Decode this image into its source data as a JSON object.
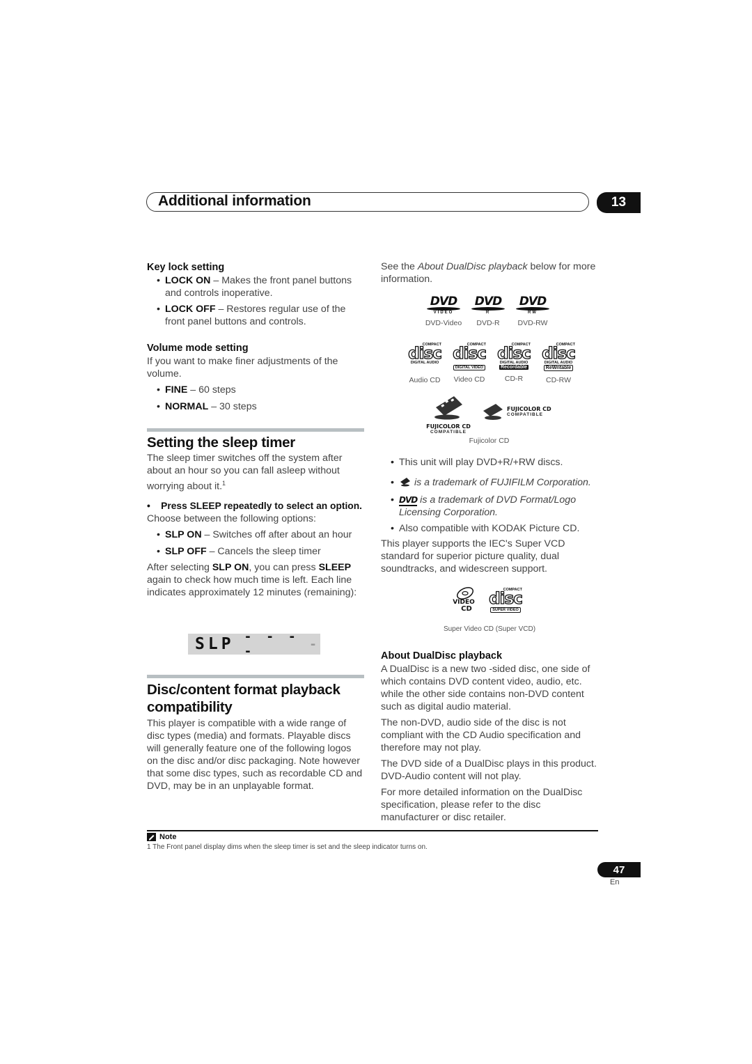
{
  "header": {
    "title": "Additional information",
    "chapter_number": "13"
  },
  "left_column": {
    "key_lock": {
      "heading": "Key lock setting",
      "items": [
        {
          "term": "LOCK ON",
          "desc": " – Makes the front panel buttons and controls inoperative."
        },
        {
          "term": "LOCK OFF",
          "desc": " – Restores regular use of the front panel buttons and controls."
        }
      ]
    },
    "volume_mode": {
      "heading": "Volume mode setting",
      "intro": "If you want to make finer adjustments of the volume.",
      "items": [
        {
          "term": "FINE",
          "desc": " – 60 steps"
        },
        {
          "term": "NORMAL",
          "desc": " – 30 steps"
        }
      ]
    },
    "sleep_timer": {
      "heading": "Setting the sleep timer",
      "intro": "The sleep timer switches off the system after about an hour so you can fall asleep without worrying about it.",
      "footnote_ref": "1",
      "step": "Press SLEEP repeatedly to select an option.",
      "choose": "Choose between the following options:",
      "items": [
        {
          "term": "SLP ON",
          "desc": " – Switches off after about an hour"
        },
        {
          "term": "SLP OFF",
          "desc": " – Cancels the sleep timer"
        }
      ],
      "after_1": "After selecting ",
      "after_bold_1": "SLP ON",
      "after_2": ", you can press ",
      "after_bold_2": "SLEEP",
      "after_3": " again to check how much time is left. Each line indicates approximately 12 minutes (remaining):",
      "display_label": "SLP",
      "display_dashes": "- - - -",
      "display_blink": "-"
    },
    "compat": {
      "heading": "Disc/content format playback compatibility",
      "body": "This player is compatible with a wide range of disc types (media) and formats. Playable discs will generally feature one of the following logos on the disc and/or disc packaging. Note however that some disc types, such as recordable CD and DVD, may be in an unplayable format."
    }
  },
  "right_column": {
    "see_pre": "See the ",
    "see_italic": "About DualDisc playback",
    "see_post": " below for more information.",
    "dvd_logos": [
      {
        "logo": "DVD",
        "sub": "VIDEO",
        "caption": "DVD-Video"
      },
      {
        "logo": "DVD",
        "sub": "R",
        "caption": "DVD-R"
      },
      {
        "logo": "DVD",
        "sub": "RW",
        "caption": "DVD-RW"
      }
    ],
    "cd_logos": [
      {
        "top": "COMPACT",
        "word": "disc",
        "sub": "DIGITAL AUDIO",
        "extra": "",
        "caption": "Audio CD"
      },
      {
        "top": "COMPACT",
        "word": "disc",
        "sub": "",
        "extra": "DIGITAL VIDEO",
        "caption": "Video CD"
      },
      {
        "top": "COMPACT",
        "word": "disc",
        "sub": "DIGITAL AUDIO",
        "extra": "Recordable",
        "caption": "CD-R"
      },
      {
        "top": "COMPACT",
        "word": "disc",
        "sub": "DIGITAL AUDIO",
        "extra": "ReWritable",
        "caption": "CD-RW"
      }
    ],
    "fuji_logos": {
      "title": "FUJICOLOR CD",
      "sub": "COMPATIBLE",
      "caption": "Fujicolor CD"
    },
    "bullets": [
      {
        "text": "This unit will play DVD+R/+RW discs.",
        "italic": false
      },
      {
        "icon": "fujicolor-icon",
        "text": " is a trademark of FUJIFILM Corporation.",
        "italic": true
      },
      {
        "icon": "dvd-logo-icon",
        "text": " is a trademark of DVD Format/Logo Licensing Corporation.",
        "italic": true
      },
      {
        "text": "Also compatible with KODAK Picture CD.",
        "italic": false
      }
    ],
    "svcd_text": "This player supports the IEC's Super VCD standard for superior picture quality, dual soundtracks, and widescreen support.",
    "svcd_logos": {
      "video_cd_top": "VIDEO",
      "video_cd_bottom": "CD",
      "compact": "COMPACT",
      "word": "disc",
      "extra": "SUPER VIDEO",
      "caption": "Super Video CD (Super VCD)"
    },
    "dualdisc": {
      "heading": "About DualDisc playback",
      "paragraphs": [
        "A DualDisc is a new two -sided disc, one side of which contains DVD content video, audio, etc. while the other side contains non-DVD content such as digital audio material.",
        "The non-DVD, audio side of the disc is not compliant with the CD Audio specification and therefore may not play.",
        "The DVD side of a DualDisc plays in this product. DVD-Audio content will not play.",
        "For more detailed information on the DualDisc specification, please refer to the disc manufacturer or disc retailer."
      ]
    }
  },
  "note": {
    "label": "Note",
    "footnote": "1 The Front panel display dims when the sleep timer is set and the sleep indicator turns on."
  },
  "footer": {
    "page_number": "47",
    "language": "En"
  }
}
